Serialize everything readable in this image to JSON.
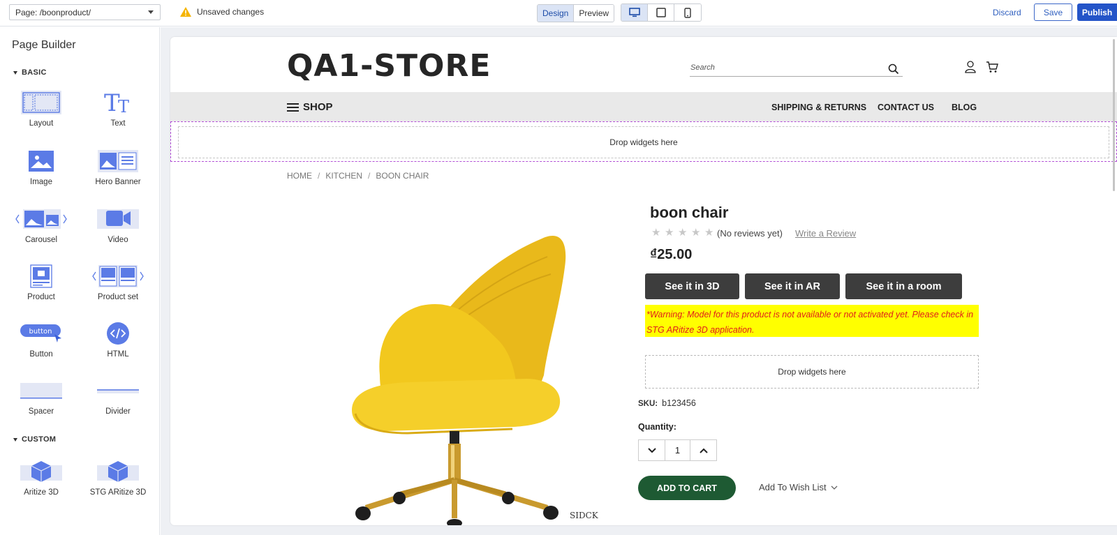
{
  "topbar": {
    "page_select": "Page: /boonproduct/",
    "unsaved": "Unsaved changes",
    "mode_design": "Design",
    "mode_preview": "Preview",
    "discard": "Discard",
    "save": "Save",
    "publish": "Publish"
  },
  "sidebar": {
    "title": "Page Builder",
    "section_basic": "BASIC",
    "section_custom": "CUSTOM",
    "widgets": {
      "layout": "Layout",
      "text": "Text",
      "image": "Image",
      "hero_banner": "Hero Banner",
      "carousel": "Carousel",
      "video": "Video",
      "product": "Product",
      "product_set": "Product set",
      "button": "Button",
      "html": "HTML",
      "spacer": "Spacer",
      "divider": "Divider",
      "aritize_3d": "Aritize 3D",
      "stg_aritize_3d": "STG ARitize 3D"
    },
    "button_icon_text": "button"
  },
  "store": {
    "logo": "QA1-STORE",
    "search_placeholder": "Search",
    "shop": "SHOP",
    "nav": [
      "SHIPPING & RETURNS",
      "CONTACT US",
      "BLOG"
    ],
    "drop_widgets": "Drop widgets here",
    "breadcrumb": [
      "HOME",
      "KITCHEN",
      "BOON CHAIR"
    ],
    "image_watermark": "SIDCK"
  },
  "product": {
    "title": "boon chair",
    "rating": 0,
    "reviews": "(No reviews yet)",
    "write_review": "Write a Review",
    "price": "₫25.00",
    "btn_3d": "See it in 3D",
    "btn_ar": "See it in AR",
    "btn_room": "See it in a room",
    "warning": "*Warning: Model for this product is not available or not activated yet. Please check in STG ARitize 3D application.",
    "drop_widgets": "Drop widgets here",
    "sku_label": "SKU:",
    "sku_value": "b123456",
    "quantity_label": "Quantity:",
    "quantity": "1",
    "add_to_cart": "ADD TO CART",
    "wishlist": "Add To Wish List"
  },
  "colors": {
    "accent": "#2454c8",
    "cart_green": "#1e5a33",
    "warning_bg": "#ffff00",
    "warning_text": "#e01b1b",
    "chair_yellow": "#f2c81e"
  }
}
